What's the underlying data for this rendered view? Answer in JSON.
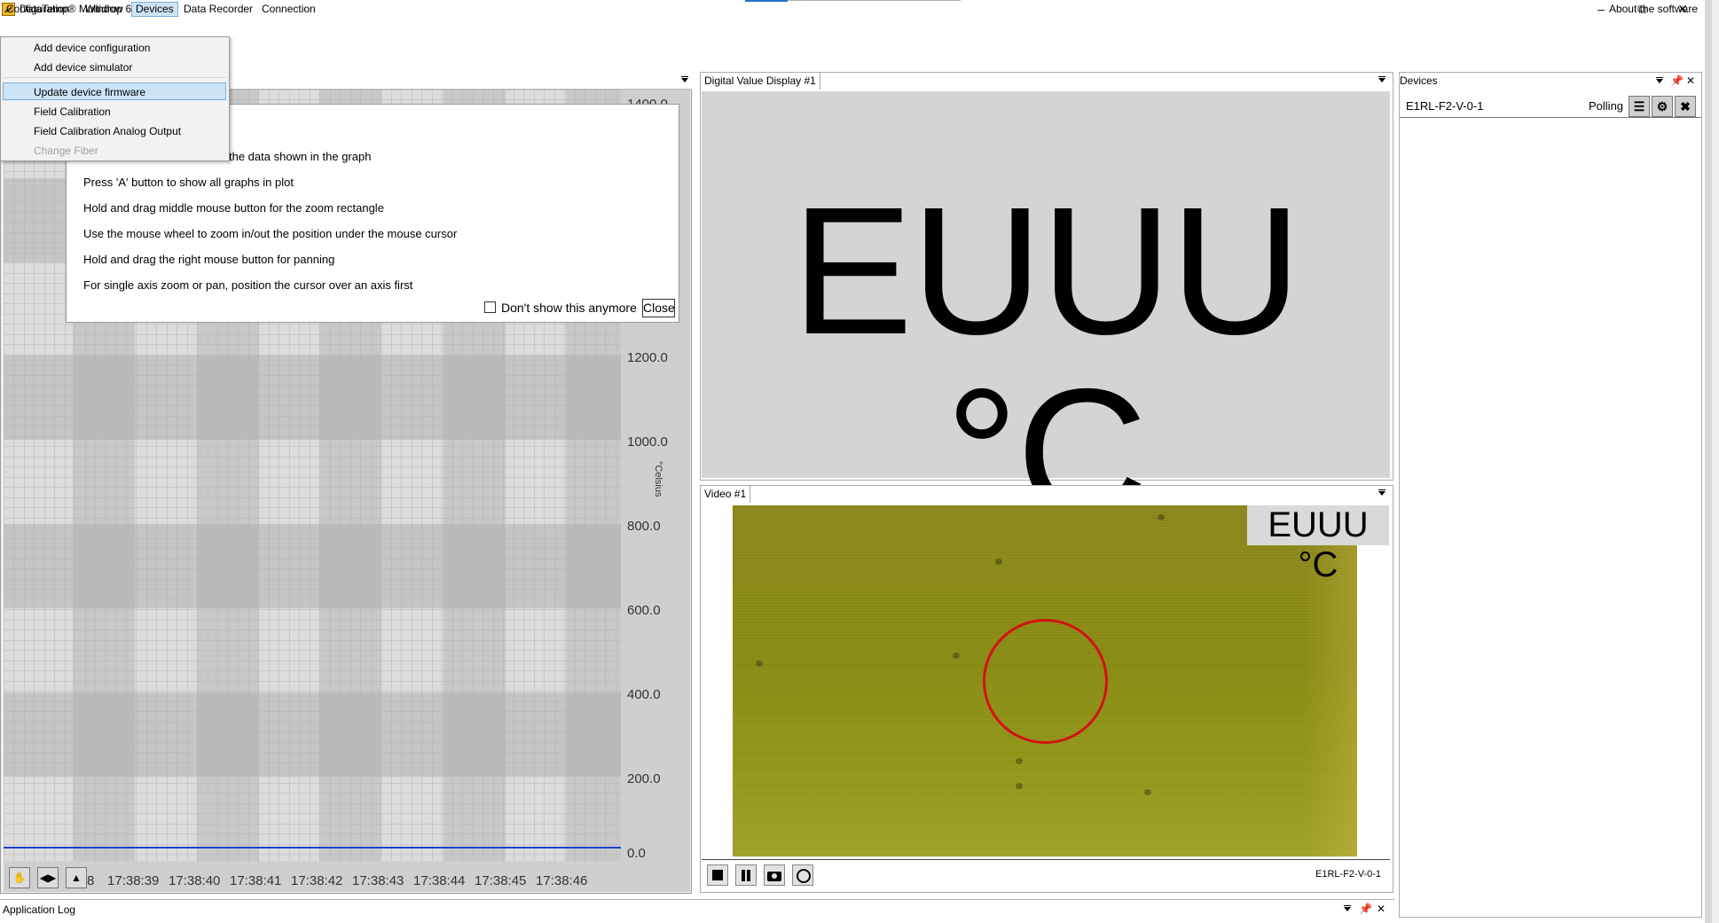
{
  "window": {
    "title": "DataTemp® Multidrop 6.1.93",
    "controls": [
      "–",
      "⧉",
      "✕"
    ]
  },
  "menubar": {
    "items": [
      "Configuration",
      "Window",
      "Devices",
      "Data Recorder",
      "Connection"
    ],
    "about": "About the software"
  },
  "devices_menu": {
    "items": [
      "Add device configuration",
      "Add device simulator",
      "Update device firmware",
      "Field Calibration",
      "Field Calibration Analog Output",
      "Change Fiber"
    ]
  },
  "graph": {
    "tips": [
      "Press ... g the data shown in the graph",
      "Press 'A' button to show all graphs in plot",
      "Hold and drag middle mouse button for the zoom rectangle",
      "Use the mouse wheel to zoom in/out the position under the mouse cursor",
      "Hold and drag the right mouse button for panning",
      "For single axis zoom or pan, position the cursor over an axis first"
    ],
    "tip_first_visible": "the data shown in the graph",
    "dont_show": "Don't show this anymore",
    "close": "Close",
    "y_ticks": [
      "1400.0",
      "1200.0",
      "1000.0",
      "800.0",
      "600.0",
      "400.0",
      "200.0",
      "0.0"
    ],
    "y_label": "°Celsius",
    "x_ticks": [
      "8",
      "17:38:39",
      "17:38:40",
      "17:38:41",
      "17:38:42",
      "17:38:43",
      "17:38:44",
      "17:38:45",
      "17:38:46"
    ]
  },
  "dvd": {
    "tab": "Digital Value Display #1",
    "value": "EUUU °C"
  },
  "video": {
    "tab": "Video #1",
    "overlay": "EUUU °C",
    "device": "E1RL-F2-V-0-1"
  },
  "devices": {
    "title": "Devices",
    "device_name": "E1RL-F2-V-0-1",
    "status": "Polling"
  },
  "applog": {
    "title": "Application Log"
  }
}
